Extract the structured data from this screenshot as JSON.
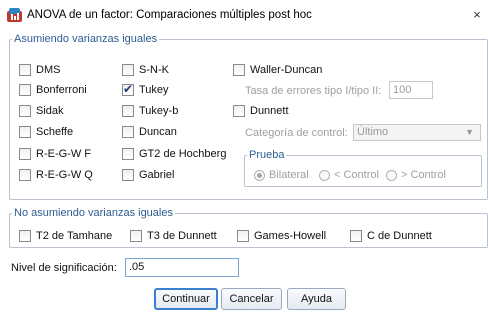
{
  "window": {
    "title": "ANOVA de un factor: Comparaciones múltiples post hoc",
    "close_glyph": "×"
  },
  "equal_variances": {
    "legend": "Asumiendo varianzas iguales",
    "tests": [
      {
        "label": "DMS",
        "checked": false
      },
      {
        "label": "Bonferroni",
        "checked": false
      },
      {
        "label": "Sidak",
        "checked": false
      },
      {
        "label": "Scheffe",
        "checked": false
      },
      {
        "label": "R-E-G-W F",
        "checked": false
      },
      {
        "label": "R-E-G-W Q",
        "checked": false
      },
      {
        "label": "S-N-K",
        "checked": false
      },
      {
        "label": "Tukey",
        "checked": true
      },
      {
        "label": "Tukey-b",
        "checked": false
      },
      {
        "label": "Duncan",
        "checked": false
      },
      {
        "label": "GT2 de Hochberg",
        "checked": false
      },
      {
        "label": "Gabriel",
        "checked": false
      }
    ],
    "waller_duncan": {
      "label": "Waller-Duncan",
      "checked": false
    },
    "error_ratio_label": "Tasa de errores tipo I/tipo II:",
    "error_ratio_value": "100",
    "dunnett": {
      "label": "Dunnett",
      "checked": false
    },
    "control_category_label": "Categoría de control:",
    "control_category_value": "Último",
    "test_group": {
      "legend": "Prueba",
      "options": [
        {
          "label": "Bilateral",
          "selected": true
        },
        {
          "label": "< Control",
          "selected": false
        },
        {
          "label": "> Control",
          "selected": false
        }
      ]
    }
  },
  "unequal_variances": {
    "legend": "No asumiendo varianzas iguales",
    "tests": [
      {
        "label": "T2 de Tamhane",
        "checked": false
      },
      {
        "label": "T3 de Dunnett",
        "checked": false
      },
      {
        "label": "Games-Howell",
        "checked": false
      },
      {
        "label": "C de Dunnett",
        "checked": false
      }
    ]
  },
  "significance": {
    "label": "Nivel de significación:",
    "value": ".05"
  },
  "buttons": {
    "continue": "Continuar",
    "cancel": "Cancelar",
    "help": "Ayuda"
  },
  "colors": {
    "legend_text": "#2d5d93",
    "group_border": "#b9c3cf",
    "default_button_border": "#3c7fd0",
    "disabled_text": "#a0a0a0"
  }
}
